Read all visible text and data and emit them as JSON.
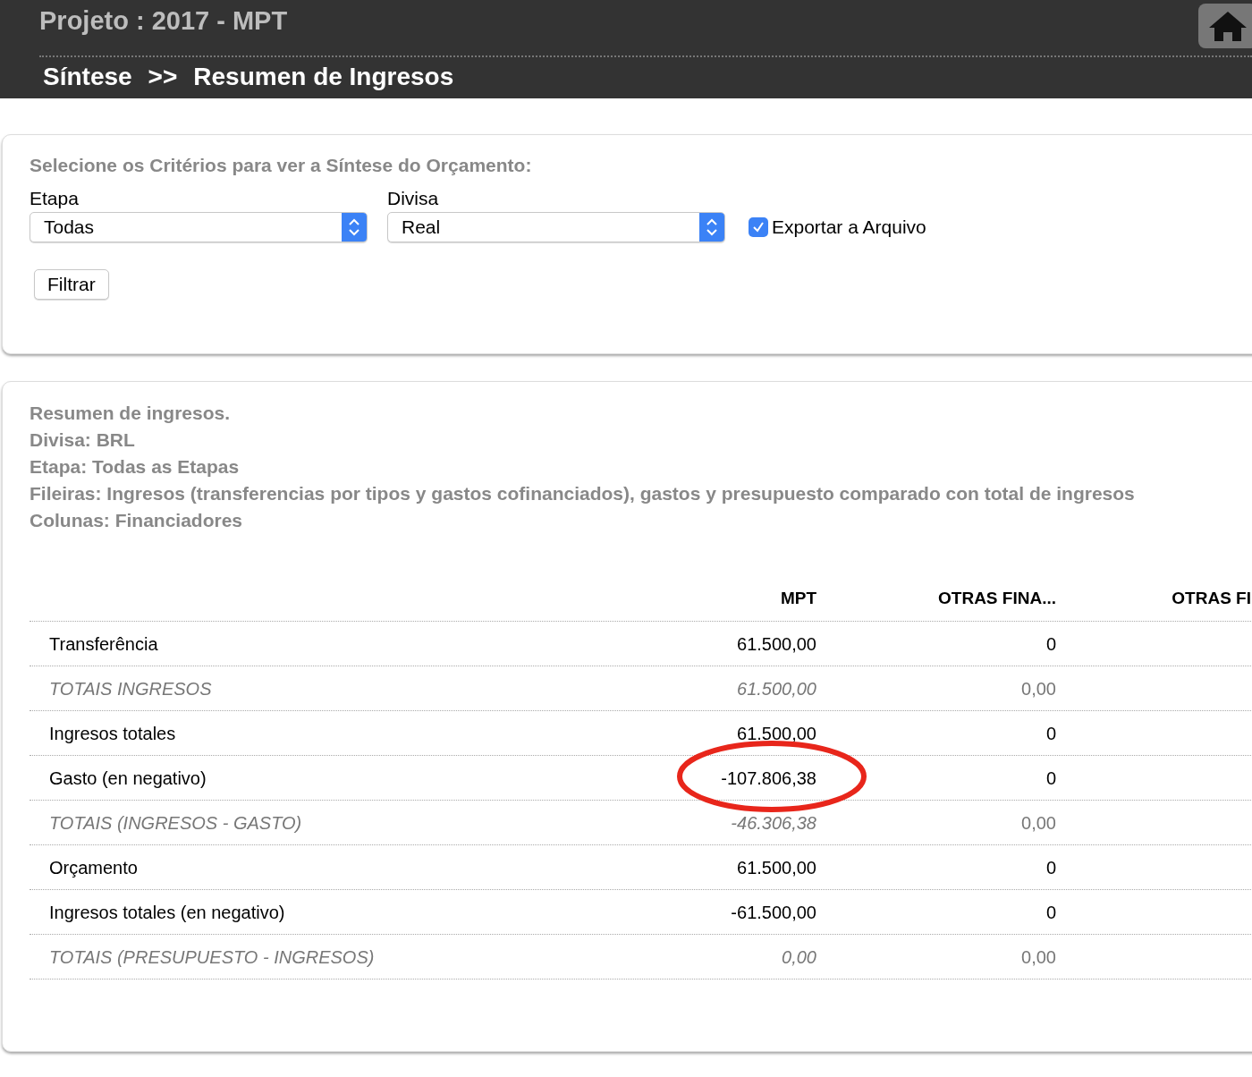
{
  "header": {
    "project": "Projeto : 2017 - MPT",
    "breadcrumb": [
      "Síntese",
      ">>",
      "Resumen de Ingresos"
    ]
  },
  "criteria": {
    "title": "Selecione os Critérios para ver a Síntese do Orçamento:",
    "fields": [
      {
        "label": "Etapa",
        "value": "Todas"
      },
      {
        "label": "Divisa",
        "value": "Real"
      }
    ],
    "export": {
      "label": "Exportar a Arquivo",
      "checked": true
    },
    "button": "Filtrar"
  },
  "summary": {
    "lines": [
      "Resumen de ingresos.",
      "Divisa: BRL",
      "Etapa: Todas as Etapas",
      "Fileiras: Ingresos (transferencias por tipos y gastos cofinanciados), gastos y presupuesto comparado con total de ingresos",
      "Colunas: Financiadores"
    ],
    "table": {
      "columns": [
        "MPT",
        "OTRAS FINA...",
        "OTRAS FI"
      ],
      "rows": [
        {
          "kind": "normal",
          "label": "Transferência",
          "mpt": "61.500,00",
          "otras": "0",
          "circled": false
        },
        {
          "kind": "total",
          "label": "TOTAIS INGRESOS",
          "mpt": "61.500,00",
          "otras": "0,00",
          "circled": false
        },
        {
          "kind": "normal",
          "label": "Ingresos totales",
          "mpt": "61.500,00",
          "otras": "0",
          "circled": false
        },
        {
          "kind": "normal",
          "label": "Gasto (en negativo)",
          "mpt": "-107.806,38",
          "otras": "0",
          "circled": true
        },
        {
          "kind": "total",
          "label": "TOTAIS (INGRESOS - GASTO)",
          "mpt": "-46.306,38",
          "otras": "0,00",
          "circled": false
        },
        {
          "kind": "normal",
          "label": "Orçamento",
          "mpt": "61.500,00",
          "otras": "0",
          "circled": false
        },
        {
          "kind": "normal",
          "label": "Ingresos totales (en negativo)",
          "mpt": "-61.500,00",
          "otras": "0",
          "circled": false
        },
        {
          "kind": "total",
          "label": "TOTAIS (PRESUPUESTO - INGRESOS)",
          "mpt": "0,00",
          "otras": "0,00",
          "circled": false
        }
      ]
    }
  }
}
